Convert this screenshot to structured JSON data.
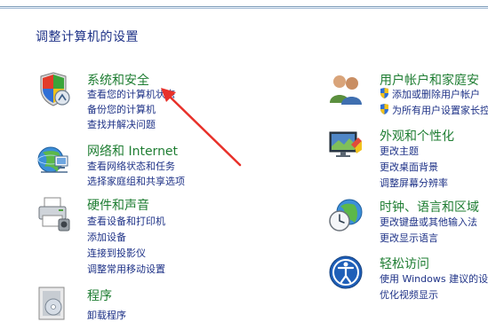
{
  "page_title": "调整计算机的设置",
  "categories": {
    "system": {
      "title": "系统和安全",
      "links": [
        "查看您的计算机状态",
        "备份您的计算机",
        "查找并解决问题"
      ]
    },
    "network": {
      "title": "网络和 Internet",
      "links": [
        "查看网络状态和任务",
        "选择家庭组和共享选项"
      ]
    },
    "hardware": {
      "title": "硬件和声音",
      "links": [
        "查看设备和打印机",
        "添加设备",
        "连接到投影仪",
        "调整常用移动设置"
      ]
    },
    "programs": {
      "title": "程序",
      "links": [
        "卸载程序"
      ]
    },
    "users": {
      "title": "用户帐户和家庭安",
      "links": [
        "添加或删除用户帐户",
        "为所有用户设置家长控"
      ]
    },
    "appearance": {
      "title": "外观和个性化",
      "links": [
        "更改主题",
        "更改桌面背景",
        "调整屏幕分辨率"
      ]
    },
    "clock": {
      "title": "时钟、语言和区域",
      "links": [
        "更改键盘或其他输入法",
        "更改显示语言"
      ]
    },
    "access": {
      "title": "轻松访问",
      "links": [
        "使用 Windows 建议的设",
        "优化视频显示"
      ]
    }
  },
  "colors": {
    "category_title": "#1e7d32",
    "link": "#1e3287",
    "annotation_arrow": "#e8312a"
  }
}
